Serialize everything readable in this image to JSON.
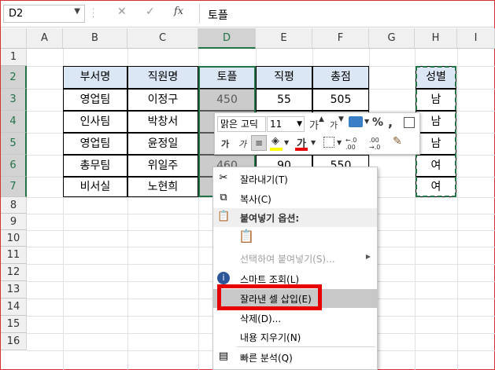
{
  "formula_bar": {
    "name_box": "D2",
    "cancel_icon": "✕",
    "enter_icon": "✓",
    "fx_label": "fx",
    "content": "토플"
  },
  "columns": [
    "A",
    "B",
    "C",
    "D",
    "E",
    "F",
    "G",
    "H",
    "I"
  ],
  "rows": [
    "1",
    "2",
    "3",
    "4",
    "5",
    "6",
    "7",
    "8",
    "9",
    "10",
    "11",
    "12",
    "13",
    "14",
    "15",
    "16"
  ],
  "table": {
    "headers": [
      "부서명",
      "직원명",
      "토플",
      "직평",
      "총점"
    ],
    "rows": [
      [
        "영업팀",
        "이정구",
        "450",
        "55",
        "505"
      ],
      [
        "인사팀",
        "박창서",
        "",
        "",
        ""
      ],
      [
        "영업팀",
        "윤정일",
        "",
        "",
        ""
      ],
      [
        "총무팀",
        "위일주",
        "460",
        "90",
        "550"
      ],
      [
        "비서실",
        "노현희",
        "",
        "",
        ""
      ]
    ]
  },
  "gender": {
    "header": "성별",
    "values": [
      "남",
      "남",
      "남",
      "여",
      "여"
    ]
  },
  "mini_toolbar": {
    "font_name": "맑은 고딕",
    "font_size": "11",
    "grow_font": "가",
    "shrink_font": "가",
    "percent": "%",
    "comma": ",",
    "bold": "가",
    "italic": "가",
    "font_color": "가",
    "inc_decimal": "←.0 .00",
    "dec_decimal": ".00 →.0"
  },
  "context_menu": {
    "cut": "잘라내기(T)",
    "copy": "복사(C)",
    "paste_options": "붙여넣기 옵션:",
    "paste_special": "선택하여 붙여넣기(S)...",
    "smart_lookup": "스마트 조회(L)",
    "insert_cut_cells": "잘라낸 셀 삽입(E)",
    "delete": "삭제(D)...",
    "clear_contents": "내용 지우기(N)",
    "quick_analysis": "빠른 분석(Q)"
  },
  "colors": {
    "accent_green": "#217346",
    "highlight_red": "#e60000",
    "header_fill": "#dbe7f5"
  }
}
